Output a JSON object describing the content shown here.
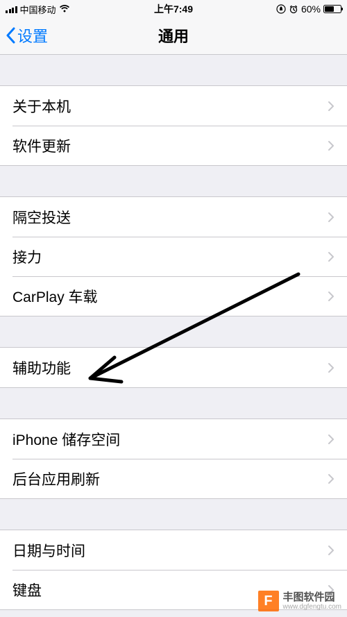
{
  "statusBar": {
    "carrier": "中国移动",
    "time": "上午7:49",
    "batteryText": "60%"
  },
  "nav": {
    "backLabel": "设置",
    "title": "通用"
  },
  "groups": [
    {
      "items": [
        {
          "label": "关于本机"
        },
        {
          "label": "软件更新"
        }
      ]
    },
    {
      "items": [
        {
          "label": "隔空投送"
        },
        {
          "label": "接力"
        },
        {
          "label": "CarPlay 车载"
        }
      ]
    },
    {
      "items": [
        {
          "label": "辅助功能"
        }
      ]
    },
    {
      "items": [
        {
          "label": "iPhone 储存空间"
        },
        {
          "label": "后台应用刷新"
        }
      ]
    },
    {
      "items": [
        {
          "label": "日期与时间"
        },
        {
          "label": "键盘"
        }
      ]
    }
  ],
  "watermark": {
    "logo": "F",
    "title": "丰图软件园",
    "url": "www.dgfengtu.com"
  }
}
